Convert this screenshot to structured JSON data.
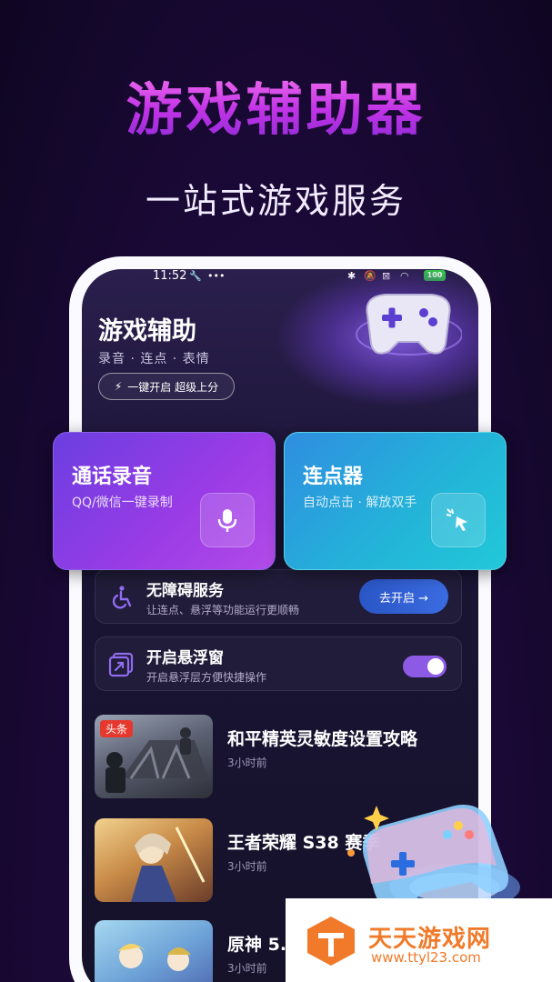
{
  "hero": {
    "title": "游戏辅助器",
    "subtitle": "一站式游戏服务"
  },
  "status_bar": {
    "time": "11:52",
    "battery": "100"
  },
  "header": {
    "title": "游戏辅助",
    "tags": "录音 · 连点 · 表情",
    "boost_button": "一键开启 超级上分"
  },
  "cards": [
    {
      "title": "通话录音",
      "subtitle": "QQ/微信一键录制",
      "icon": "microphone-icon"
    },
    {
      "title": "连点器",
      "subtitle": "自动点击 · 解放双手",
      "icon": "cursor-click-icon"
    }
  ],
  "accessibility": {
    "title": "无障碍服务",
    "subtitle": "让连点、悬浮等功能运行更顺畅",
    "button": "去开启 →",
    "icon": "wheelchair-icon"
  },
  "floating_window": {
    "title": "开启悬浮窗",
    "subtitle": "开启悬浮层方便快捷操作",
    "toggle_on": true,
    "icon": "floating-window-icon"
  },
  "news": [
    {
      "badge": "头条",
      "title": "和平精英灵敏度设置攻略",
      "time": "3小时前"
    },
    {
      "badge": "",
      "title": "王者荣耀 S38 赛季",
      "time": "3小时前"
    },
    {
      "badge": "",
      "title": "原神 5.",
      "time": "3小时前"
    }
  ],
  "watermark": {
    "name": "天天游戏网",
    "url": "www.ttyl23.com"
  },
  "colors": {
    "accent_purple": "#9b3ce6",
    "accent_cyan": "#23b5d8",
    "toggle": "#8d5ae6",
    "badge_red": "#e5392f",
    "watermark_orange": "#f07a2a"
  }
}
